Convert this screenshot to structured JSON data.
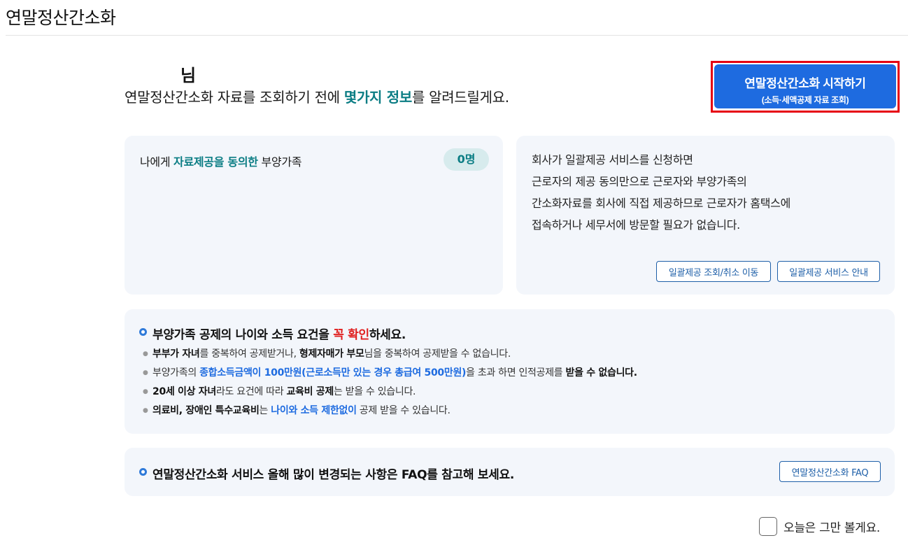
{
  "page": {
    "title": "연말정산간소화"
  },
  "greeting": {
    "name_suffix": "님",
    "intro_before": "연말정산간소화 자료를 조회하기 전에 ",
    "intro_highlight": "몇가지 정보",
    "intro_after": "를 알려드릴게요."
  },
  "start_button": {
    "label": "연말정산간소화 시작하기",
    "sublabel": "(소득·세액공제 자료 조회)"
  },
  "family_card": {
    "label_before": "나에게 ",
    "label_highlight": "자료제공을 동의한",
    "label_after": " 부양가족",
    "count": "0명"
  },
  "info_card": {
    "lines": [
      "회사가 일괄제공 서비스를 신청하면",
      "근로자의 제공 동의만으로 근로자와 부양가족의",
      "간소화자료를 회사에 직접 제공하므로 근로자가 홈택스에",
      "접속하거나 세무서에 방문할 필요가 없습니다."
    ],
    "btn_lookup": "일괄제공 조회/취소 이동",
    "btn_guide": "일괄제공 서비스 안내"
  },
  "rules_card": {
    "heading_before": "부양가족 공제의 나이와 소득 요건을 ",
    "heading_red": "꼭 확인",
    "heading_after": "하세요.",
    "item1": {
      "b1": "부부가 자녀",
      "t1": "를 중복하여 공제받거나, ",
      "b2": "형제자매가 부모",
      "t2": "님을 중복하여 공제받을 수 없습니다."
    },
    "item2": {
      "t1": "부양가족의 ",
      "blue": "종합소득금액이 100만원(근로소득만 있는 경우 총급여 500만원)",
      "t2": "을 초과 하면 인적공제를 ",
      "b1": "받을 수 없습니다."
    },
    "item3": {
      "b1": "20세 이상 자녀",
      "t1": "라도 요건에 따라 ",
      "b2": "교육비 공제",
      "t2": "는 받을 수 있습니다."
    },
    "item4": {
      "b1": "의료비, 장애인 특수교육비",
      "t1": "는 ",
      "blue": "나이와 소득 제한없이",
      "t2": " 공제 받을 수 있습니다."
    }
  },
  "faq_card": {
    "text": "연말정산간소화 서비스 올해 많이 변경되는 사항은 FAQ를 참고해 보세요.",
    "button": "연말정산간소화 FAQ"
  },
  "dont_show": {
    "label": "오늘은 그만 볼게요."
  },
  "colors": {
    "accent_blue": "#1e6be0",
    "teal": "#0b7d84",
    "red_outline": "#e60012",
    "card_bg": "#f3f6fb"
  }
}
